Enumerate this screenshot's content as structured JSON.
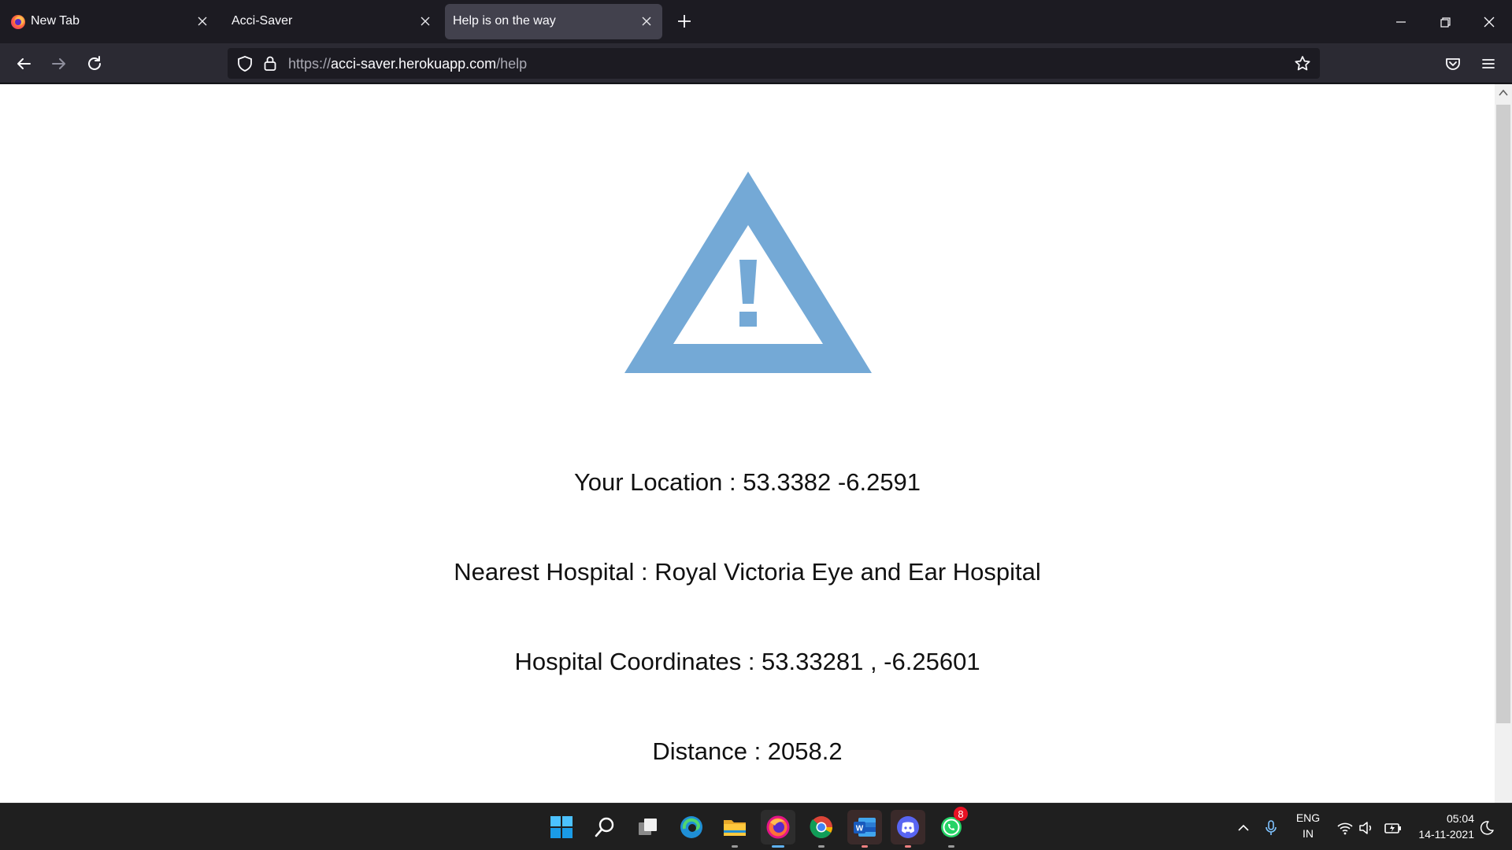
{
  "browser": {
    "tabs": [
      {
        "label": "New Tab",
        "active": false
      },
      {
        "label": "Acci-Saver",
        "active": false
      },
      {
        "label": "Help is on the way",
        "active": true
      }
    ],
    "url": {
      "scheme": "https://",
      "host": "acci-saver.herokuapp.com",
      "path": "/help"
    }
  },
  "page": {
    "warning_icon": "warning-triangle-icon",
    "warning_color": "#74a9d6",
    "location_label": "Your Location : 53.3382 -6.2591",
    "hospital_label": "Nearest Hospital : Royal Victoria Eye and Ear Hospital",
    "coordinates_label": "Hospital Coordinates : 53.33281 , -6.25601",
    "distance_label": "Distance : 2058.2"
  },
  "taskbar": {
    "apps": [
      "start",
      "search",
      "task-view",
      "edge",
      "file-explorer",
      "firefox",
      "chrome",
      "word",
      "discord",
      "whatsapp"
    ],
    "whatsapp_badge": "8",
    "language_top": "ENG",
    "language_bottom": "IN",
    "time": "05:04",
    "date": "14-11-2021"
  }
}
